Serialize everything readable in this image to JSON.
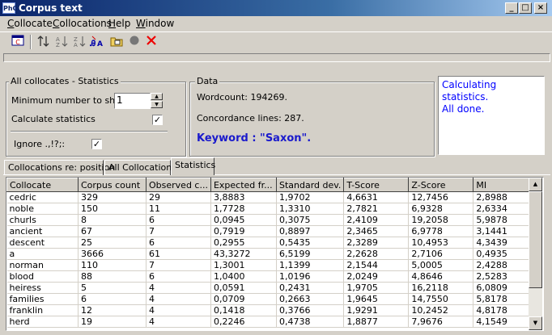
{
  "window": {
    "app_icon": "PhC",
    "title": "Corpus text",
    "controls": [
      "_",
      "□",
      "×"
    ]
  },
  "menu": [
    "Collocate",
    "Collocations",
    "Help",
    "Window"
  ],
  "toolbar": {
    "icons": [
      "collocate-window-icon",
      "sort-up-down-icon",
      "sort-az-icon",
      "sort-za-icon",
      "sort-a-bold-icon",
      "open-folder-icon",
      "stop-circle-icon",
      "cancel-x-icon"
    ]
  },
  "settings": {
    "group_title": "All collocates - Statistics",
    "min_label": "Minimum number to show",
    "min_value": "1",
    "calc_label": "Calculate statistics",
    "calc_checked": "✓",
    "ignore_label": "Ignore .,!?;:",
    "ignore_checked": "✓"
  },
  "data_panel": {
    "group_title": "Data",
    "wordcount": "Wordcount: 194269.",
    "concordance": "Concordance lines: 287.",
    "keyword": "Keyword : \"Saxon\"."
  },
  "log": {
    "line1": "Calculating statistics.",
    "line2": "All done."
  },
  "tabs": [
    "Collocations re: position",
    "All Collocations",
    "Statistics"
  ],
  "active_tab": "Statistics",
  "table": {
    "columns": [
      "Collocate",
      "Corpus count",
      "Observed c...",
      "Expected fr...",
      "Standard dev.",
      "T-Score",
      "Z-Score",
      "MI"
    ],
    "rows": [
      [
        "cedric",
        "329",
        "29",
        "3,8883",
        "1,9702",
        "4,6631",
        "12,7456",
        "2,8988"
      ],
      [
        "noble",
        "150",
        "11",
        "1,7728",
        "1,3310",
        "2,7821",
        "6,9328",
        "2,6334"
      ],
      [
        "churls",
        "8",
        "6",
        "0,0945",
        "0,3075",
        "2,4109",
        "19,2058",
        "5,9878"
      ],
      [
        "ancient",
        "67",
        "7",
        "0,7919",
        "0,8897",
        "2,3465",
        "6,9778",
        "3,1441"
      ],
      [
        "descent",
        "25",
        "6",
        "0,2955",
        "0,5435",
        "2,3289",
        "10,4953",
        "4,3439"
      ],
      [
        "a",
        "3666",
        "61",
        "43,3272",
        "6,5199",
        "2,2628",
        "2,7106",
        "0,4935"
      ],
      [
        "norman",
        "110",
        "7",
        "1,3001",
        "1,1399",
        "2,1544",
        "5,0005",
        "2,4288"
      ],
      [
        "blood",
        "88",
        "6",
        "1,0400",
        "1,0196",
        "2,0249",
        "4,8646",
        "2,5283"
      ],
      [
        "heiress",
        "5",
        "4",
        "0,0591",
        "0,2431",
        "1,9705",
        "16,2118",
        "6,0809"
      ],
      [
        "families",
        "6",
        "4",
        "0,0709",
        "0,2663",
        "1,9645",
        "14,7550",
        "5,8178"
      ],
      [
        "franklin",
        "12",
        "4",
        "0,1418",
        "0,3766",
        "1,9291",
        "10,2452",
        "4,8178"
      ],
      [
        "herd",
        "19",
        "4",
        "0,2246",
        "0,4738",
        "1,8877",
        "7,9676",
        "4,1549"
      ]
    ]
  }
}
